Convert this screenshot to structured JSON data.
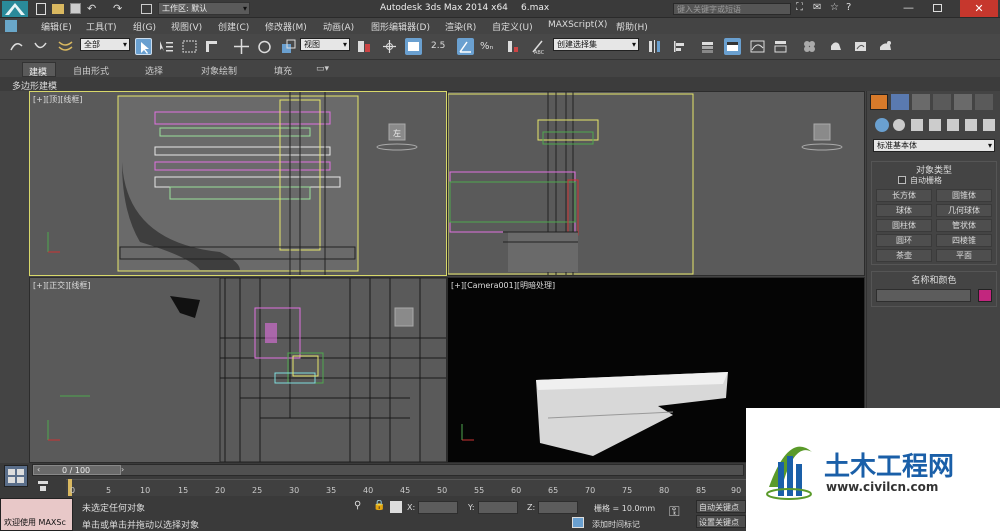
{
  "titlebar": {
    "workspace_label": "工作区: 默认",
    "app_title": "Autodesk 3ds Max  2014 x64",
    "file_name": "6.max",
    "search_placeholder": "键入关键字或短语"
  },
  "menubar": {
    "items": [
      "编辑(E)",
      "工具(T)",
      "组(G)",
      "视图(V)",
      "创建(C)",
      "修改器(M)",
      "动画(A)",
      "图形编辑器(D)",
      "渲染(R)",
      "自定义(U)",
      "MAXScript(X)",
      "帮助(H)"
    ]
  },
  "toolbar": {
    "selection_filter": "全部",
    "ref_coord": "视图",
    "snap_label": "2.5",
    "named_selection": "创建选择集"
  },
  "ribbon": {
    "tabs": [
      "建模",
      "自由形式",
      "选择",
      "对象绘制",
      "填充"
    ],
    "active_tab": "建模",
    "sub_label": "多边形建模"
  },
  "viewports": {
    "top": {
      "label_plus": "[+]",
      "label_view": "[顶]",
      "label_shade": "[线框]"
    },
    "right": {
      "label_plus": "",
      "label_view": "",
      "label_shade": ""
    },
    "front": {
      "label_plus": "[+]",
      "label_view": "[正交]",
      "label_shade": "[线框]"
    },
    "camera": {
      "label_plus": "[+]",
      "label_view": "[Camera001]",
      "label_shade": "[明暗处理]"
    },
    "cube_label": "左"
  },
  "command_panel": {
    "dropdown": "标准基本体",
    "section_object_type": "对象类型",
    "autogrid": "自动栅格",
    "buttons": [
      "长方体",
      "圆锥体",
      "球体",
      "几何球体",
      "圆柱体",
      "管状体",
      "圆环",
      "四棱锥",
      "茶壶",
      "平面"
    ],
    "section_name_color": "名称和颜色",
    "object_color": "#c2267e"
  },
  "timeline": {
    "frame_counter": "0 / 100",
    "ruler_ticks": [
      "0",
      "5",
      "10",
      "15",
      "20",
      "25",
      "30",
      "35",
      "40",
      "45",
      "50",
      "55",
      "60",
      "65",
      "70",
      "75",
      "80",
      "85",
      "90"
    ]
  },
  "status": {
    "welcome": "欢迎使用 MAXSc",
    "selection": "未选定任何对象",
    "prompt": "单击或单击并拖动以选择对象",
    "x_label": "X:",
    "y_label": "Y:",
    "z_label": "Z:",
    "grid": "栅格 = 10.0mm",
    "auto_key": "自动关键点",
    "set_key": "设置关键点",
    "add_time_tag": "添加时间标记"
  },
  "watermark": {
    "brand": "土木工程网",
    "url": "www.civilcn.com"
  }
}
